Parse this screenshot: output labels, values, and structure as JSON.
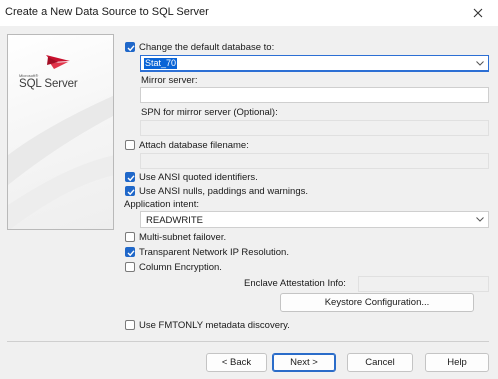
{
  "window": {
    "title": "Create a New Data Source to SQL Server",
    "close_glyph": "✕"
  },
  "logo": {
    "microsoft": "Microsoft®",
    "product": "SQL Server"
  },
  "change_db": {
    "label": "Change the default database to:",
    "checked": true,
    "value": "Stat_70"
  },
  "mirror": {
    "label": "Mirror server:",
    "value": ""
  },
  "spn": {
    "label": "SPN for mirror server (Optional):",
    "value": ""
  },
  "attach": {
    "label": "Attach database filename:",
    "checked": false,
    "value": ""
  },
  "ansi_quoted": {
    "label": "Use ANSI quoted identifiers.",
    "checked": true
  },
  "ansi_nulls": {
    "label": "Use ANSI nulls, paddings and warnings.",
    "checked": true
  },
  "app_intent": {
    "label": "Application intent:",
    "value": "READWRITE"
  },
  "multi_subnet": {
    "label": "Multi-subnet failover.",
    "checked": false
  },
  "transparent_ip": {
    "label": "Transparent Network IP Resolution.",
    "checked": true
  },
  "column_enc": {
    "label": "Column Encryption.",
    "checked": false
  },
  "enclave": {
    "label": "Enclave Attestation Info:",
    "value": ""
  },
  "keystore": {
    "label": "Keystore Configuration..."
  },
  "fmtonly": {
    "label": "Use FMTONLY metadata discovery.",
    "checked": false
  },
  "buttons": {
    "back": "< Back",
    "next": "Next >",
    "cancel": "Cancel",
    "help": "Help"
  },
  "colors": {
    "accent": "#1f67c9",
    "dialog_bg": "#f0f0f0",
    "selection": "#0a64d6"
  },
  "icons": {
    "check": "check-icon",
    "chevron": "chevron-down-icon",
    "close": "close-icon"
  }
}
